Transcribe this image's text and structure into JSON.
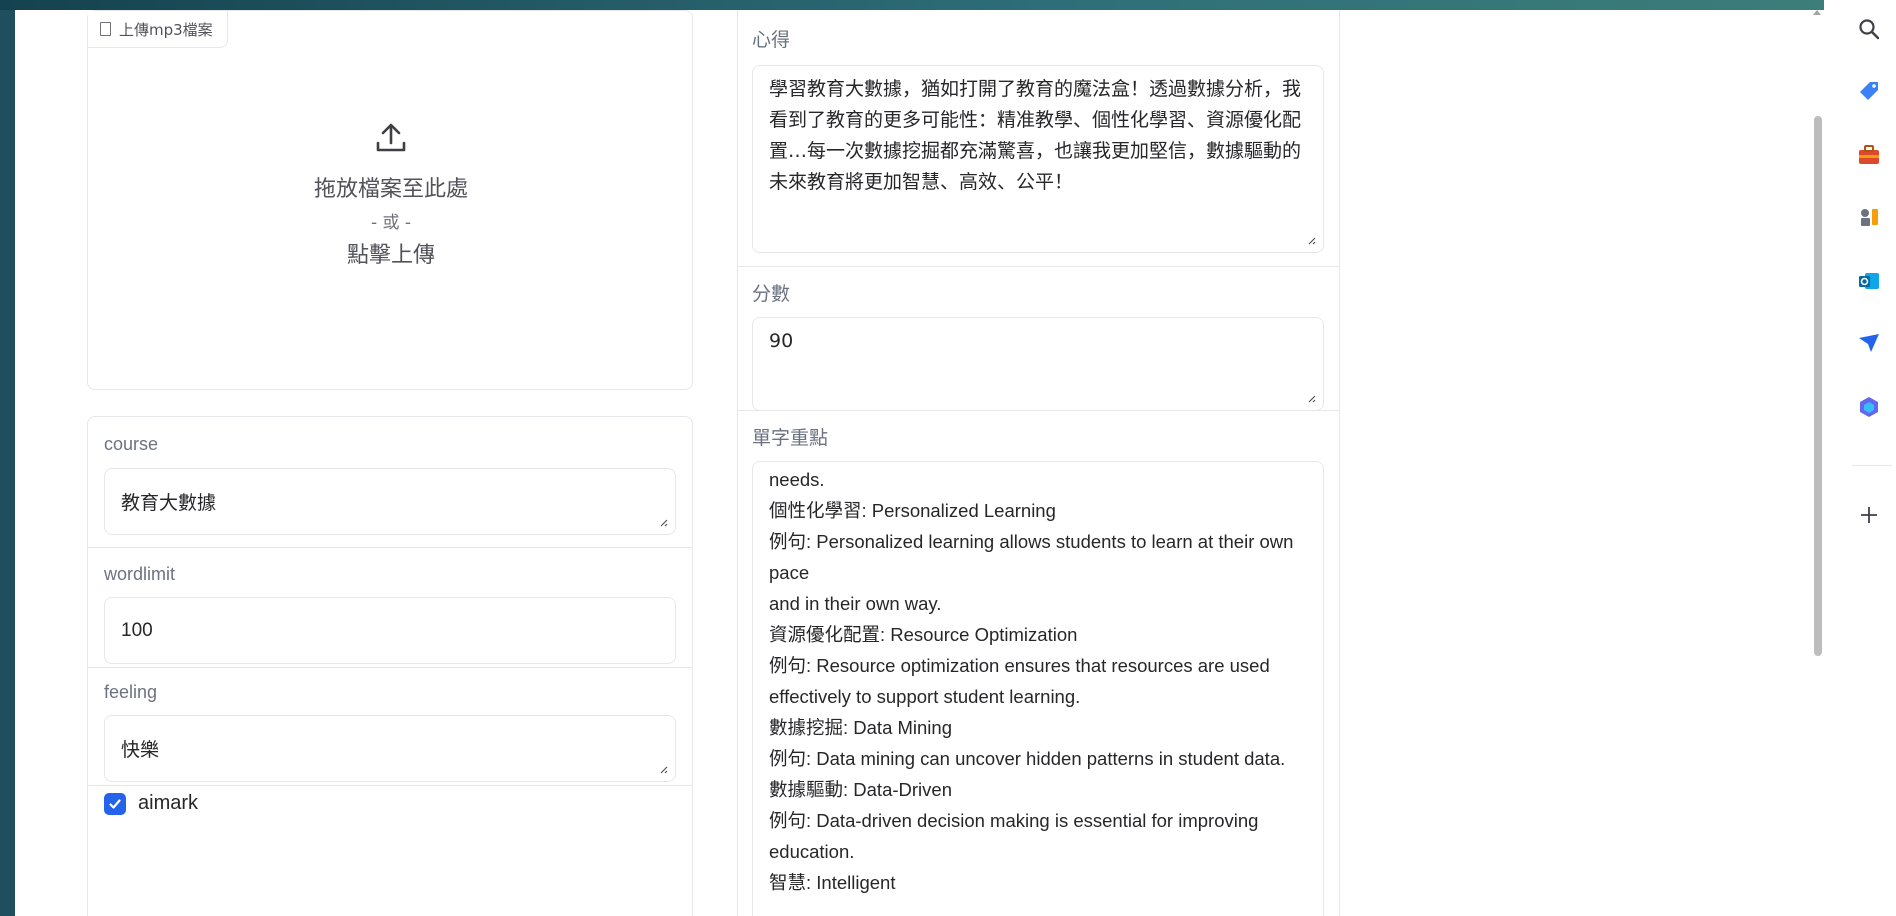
{
  "upload": {
    "tag_label": "上傳mp3檔案",
    "drop_text": "拖放檔案至此處",
    "or_text": "- 或 -",
    "click_text": "點擊上傳"
  },
  "form": {
    "course": {
      "label": "course",
      "value": "教育大數據"
    },
    "wordlimit": {
      "label": "wordlimit",
      "value": "100"
    },
    "feeling": {
      "label": "feeling",
      "value": "快樂"
    },
    "aimark": {
      "label": "aimark",
      "checked": true
    }
  },
  "output": {
    "reflection": {
      "label": "心得",
      "text": "學習教育大數據，猶如打開了教育的魔法盒！透過數據分析，我看到了教育的更多可能性：精准教學、個性化學習、資源優化配置…每一次數據挖掘都充滿驚喜，也讓我更加堅信，數據驅動的未來教育將更加智慧、高效、公平！"
    },
    "score": {
      "label": "分數",
      "value": "90"
    },
    "vocab": {
      "label": "單字重點",
      "lines": [
        "needs.",
        "個性化學習: Personalized Learning",
        "例句: Personalized learning allows students to learn at their own pace",
        "and in their own way.",
        "資源優化配置: Resource Optimization",
        "例句: Resource optimization ensures that resources are used",
        "effectively to support student learning.",
        "數據挖掘: Data Mining",
        "例句: Data mining can uncover hidden patterns in student data.",
        "數據驅動: Data-Driven",
        "例句: Data-driven decision making is essential for improving",
        "education.",
        "智慧: Intelligent"
      ]
    }
  },
  "sidebar_icons": [
    "search-icon",
    "tag-icon",
    "briefcase-icon",
    "chess-icon",
    "outlook-icon",
    "send-icon",
    "copilot-icon",
    "add-icon"
  ],
  "colors": {
    "accent": "#2563eb",
    "background": "#1f4f5e"
  }
}
